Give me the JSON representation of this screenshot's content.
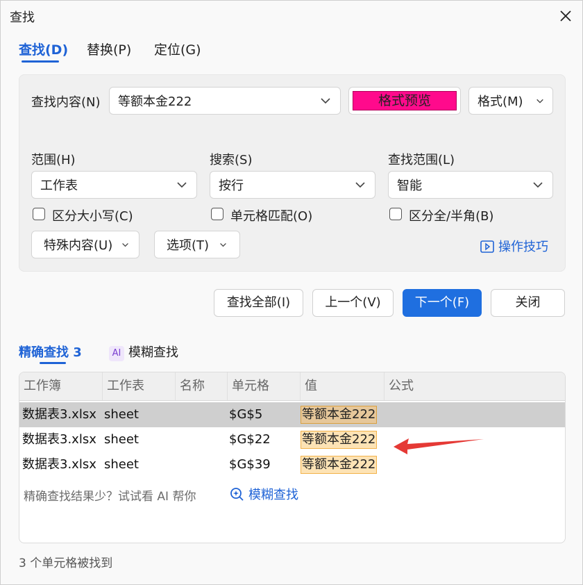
{
  "window": {
    "title": "查找"
  },
  "tabs": [
    {
      "label": "查找(D)",
      "active": true
    },
    {
      "label": "替换(P)",
      "active": false
    },
    {
      "label": "定位(G)",
      "active": false
    }
  ],
  "find": {
    "label": "查找内容(N)",
    "value": "等额本金222",
    "preview_label": "格式预览",
    "preview_color": "#ff0a8c",
    "format_button": "格式(M)"
  },
  "options": {
    "scope_label": "范围(H)",
    "scope_value": "工作表",
    "search_label": "搜索(S)",
    "search_value": "按行",
    "lookin_label": "查找范围(L)",
    "lookin_value": "智能",
    "match_case": {
      "label": "区分大小写(C)",
      "checked": false
    },
    "match_cell": {
      "label": "单元格匹配(O)",
      "checked": false
    },
    "match_width": {
      "label": "区分全/半角(B)",
      "checked": false
    },
    "special_button": "特殊内容(U)",
    "options_button": "选项(T)",
    "tips_link": "操作技巧"
  },
  "actions": {
    "find_all": "查找全部(I)",
    "prev": "上一个(V)",
    "next": "下一个(F)",
    "close": "关闭"
  },
  "result_tabs": {
    "exact": "精确查找 3",
    "ai_badge": "AI",
    "fuzzy": "模糊查找"
  },
  "results": {
    "columns": [
      "工作簿",
      "工作表",
      "名称",
      "单元格",
      "值",
      "公式"
    ],
    "rows": [
      {
        "workbook": "数据表3.xlsx",
        "sheet": "sheet",
        "name": "",
        "cell": "$G$5",
        "value": "等额本金222",
        "formula": ""
      },
      {
        "workbook": "数据表3.xlsx",
        "sheet": "sheet",
        "name": "",
        "cell": "$G$22",
        "value": "等额本金222",
        "formula": ""
      },
      {
        "workbook": "数据表3.xlsx",
        "sheet": "sheet",
        "name": "",
        "cell": "$G$39",
        "value": "等额本金222",
        "formula": ""
      }
    ],
    "hint": "精确查找结果少？试试看 AI 帮你",
    "fuzzy_link": "模糊查找"
  },
  "status": "3 个单元格被找到",
  "colors": {
    "accent": "#1f63d6",
    "highlight": "#fde3b5",
    "arrow": "#e53935"
  }
}
